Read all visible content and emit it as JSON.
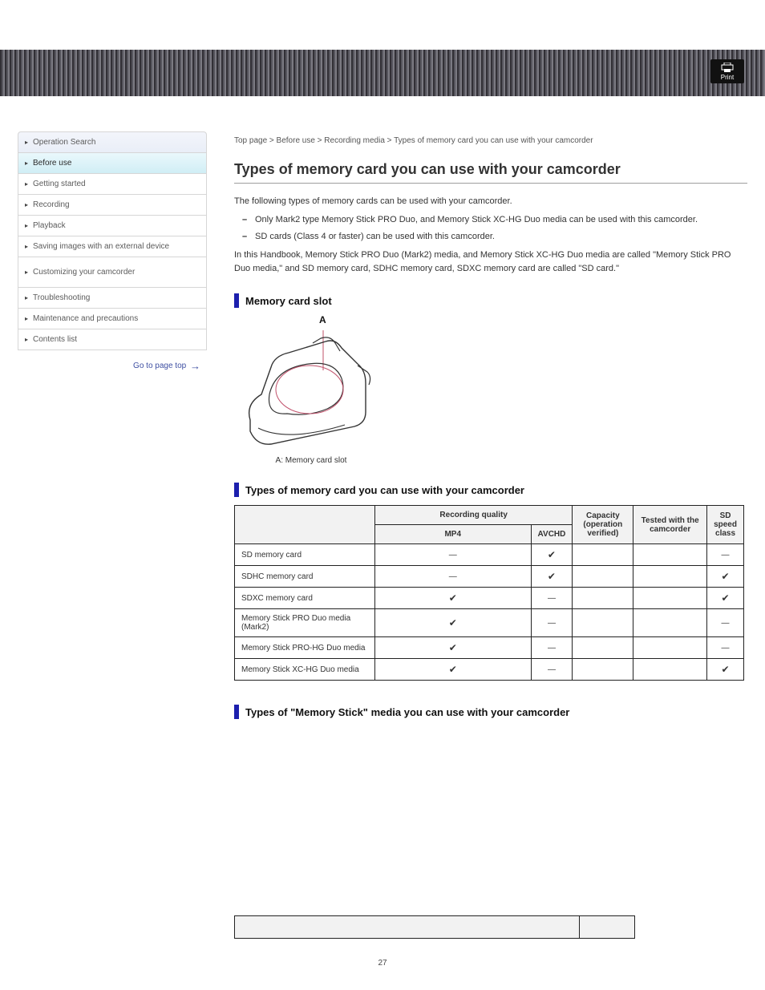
{
  "header": {
    "brand": "",
    "model": "",
    "print": "Print"
  },
  "sidebar": {
    "items": [
      "Operation Search",
      "Before use",
      "Getting started",
      "Recording",
      "Playback",
      "Saving images with an external device",
      "Customizing your camcorder",
      "Troubleshooting",
      "Maintenance and precautions",
      "Contents list"
    ],
    "goto": "Go to page top"
  },
  "breadcrumb": "Top page > Before use > Recording media > Types of memory card you can use with your camcorder",
  "page_title": "Types of memory card you can use with your camcorder",
  "intro": {
    "p1": "The following types of memory cards can be used with your camcorder.",
    "b1": "Only Mark2 type Memory Stick PRO Duo, and Memory Stick XC-HG Duo media can be used with this camcorder.",
    "b2": "SD cards (Class 4 or faster) can be used with this camcorder.",
    "p2": "In this Handbook, Memory Stick PRO Duo (Mark2) media, and Memory Stick XC-HG Duo media are called \"Memory Stick PRO Duo media,\" and SD memory card, SDHC memory card, SDXC memory card are called \"SD card.\""
  },
  "slot_heading": "Memory card slot",
  "slot_caption": "A: Memory card slot",
  "table1_heading": "Types of memory card you can use with your camcorder",
  "table1": {
    "headers": {
      "col0": "",
      "rec": "Recording quality",
      "mp4": "MP4",
      "avchd": "AVCHD",
      "capacity": "Capacity (operation verified)",
      "tested": "Tested with the camcorder",
      "cls": "SD speed class"
    },
    "rows": [
      {
        "c0": "SD memory card",
        "mp4": "dash",
        "avchd": "check",
        "cap": "",
        "tested": "",
        "cls": "dash"
      },
      {
        "c0": "SDHC memory card",
        "mp4": "dash",
        "avchd": "check",
        "cap": "",
        "tested": "",
        "cls": "check"
      },
      {
        "c0": "SDXC memory card",
        "mp4": "check",
        "avchd": "dash",
        "cap": "",
        "tested": "",
        "cls": "check"
      },
      {
        "c0": "Memory Stick PRO Duo media (Mark2)",
        "mp4": "check",
        "avchd": "dash",
        "cap": "",
        "tested": "",
        "cls": "dash"
      },
      {
        "c0": "Memory Stick PRO-HG Duo media",
        "mp4": "check",
        "avchd": "dash",
        "cap": "",
        "tested": "",
        "cls": "dash"
      },
      {
        "c0": "Memory Stick XC-HG Duo media",
        "mp4": "check",
        "avchd": "dash",
        "cap": "",
        "tested": "",
        "cls": "check"
      }
    ]
  },
  "table2_heading": "Types of \"Memory Stick\" media you can use with your camcorder",
  "footer_table": {
    "h0": "",
    "h1": ""
  },
  "page_number": "27"
}
